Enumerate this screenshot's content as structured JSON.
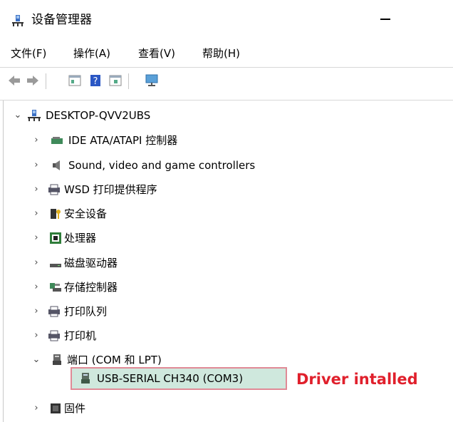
{
  "window": {
    "title": "设备管理器"
  },
  "menu": [
    "文件(F)",
    "操作(A)",
    "查看(V)",
    "帮助(H)"
  ],
  "toolbar": [
    "back-icon",
    "forward-icon",
    "properties-icon",
    "help-icon",
    "update-icon",
    "monitor-icon"
  ],
  "tree": {
    "root": "DESKTOP-QVV2UBS",
    "nodes": [
      {
        "label": "IDE ATA/ATAPI 控制器",
        "expanded": false
      },
      {
        "label": "Sound, video and game controllers",
        "expanded": false
      },
      {
        "label": "WSD 打印提供程序",
        "expanded": false
      },
      {
        "label": "安全设备",
        "expanded": false
      },
      {
        "label": "处理器",
        "expanded": false
      },
      {
        "label": "磁盘驱动器",
        "expanded": false
      },
      {
        "label": "存储控制器",
        "expanded": false
      },
      {
        "label": "打印队列",
        "expanded": false
      },
      {
        "label": "打印机",
        "expanded": false
      },
      {
        "label": "端口 (COM 和 LPT)",
        "expanded": true
      },
      {
        "label": "USB-SERIAL CH340 (COM3)",
        "child": true,
        "selected": true
      },
      {
        "label": "固件",
        "expanded": false
      }
    ]
  },
  "annotation": "Driver intalled",
  "colors": {
    "annotation": "#e0202c",
    "selected_bg": "#cfe8dd",
    "selected_border": "#e08a96"
  }
}
